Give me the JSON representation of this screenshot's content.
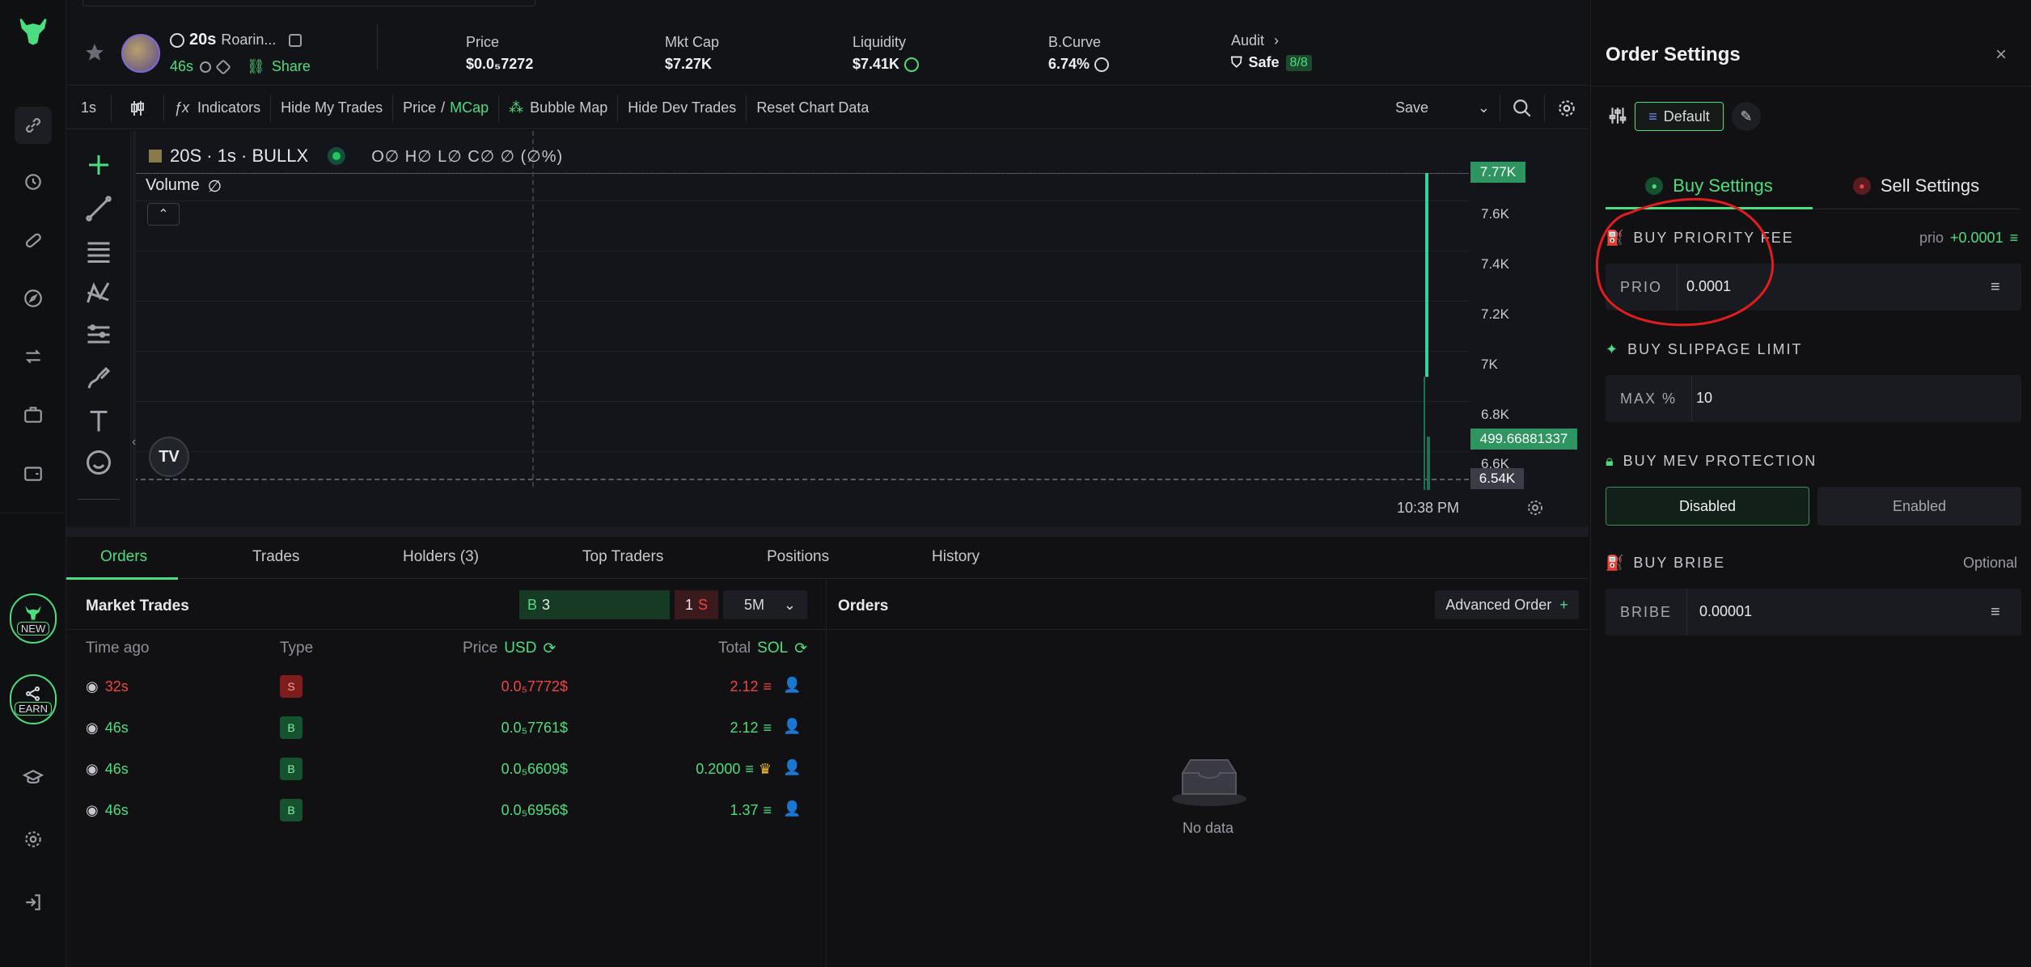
{
  "token": {
    "symbol": "20s",
    "name": "Roarin...",
    "age": "46s",
    "share_label": "Share"
  },
  "stats": [
    {
      "label": "Price",
      "value": "$0.0₅7272"
    },
    {
      "label": "Mkt Cap",
      "value": "$7.27K"
    },
    {
      "label": "Liquidity",
      "value": "$7.41K"
    },
    {
      "label": "B.Curve",
      "value": "6.74%"
    },
    {
      "label": "Audit",
      "value": "Safe",
      "badge": "8/8"
    }
  ],
  "toolbar": {
    "interval": "1s",
    "indicators": "Indicators",
    "hide_my_trades": "Hide My Trades",
    "price": "Price",
    "mcap": "MCap",
    "bubble_map": "Bubble Map",
    "hide_dev_trades": "Hide Dev Trades",
    "reset_chart": "Reset Chart Data",
    "save": "Save"
  },
  "chart": {
    "legend_title": "20S · 1s · BULLX",
    "ohlc": "O∅ H∅ L∅ C∅ ∅ (∅%)",
    "volume_label": "Volume",
    "volume_value": "∅",
    "price_ticks": [
      "7.6K",
      "7.4K",
      "7.2K",
      "7K",
      "6.8K",
      "6.6K"
    ],
    "top_tag": "7.77K",
    "volume_tag": "499.66881337",
    "last_tag": "6.54K",
    "time_label": "10:38 PM"
  },
  "tabs": [
    "Orders",
    "Trades",
    "Holders (3)",
    "Top Traders",
    "Positions",
    "History"
  ],
  "market_trades": {
    "title": "Market Trades",
    "buy_count": "3",
    "sell_count": "1",
    "buy_letter": "B",
    "sell_letter": "S",
    "interval": "5M",
    "headers": {
      "time": "Time ago",
      "type": "Type",
      "price": "Price",
      "price_unit": "USD",
      "total": "Total",
      "total_unit": "SOL"
    },
    "rows": [
      {
        "time": "32s",
        "type": "S",
        "price": "0.0₅7772$",
        "total": "2.12"
      },
      {
        "time": "46s",
        "type": "B",
        "price": "0.0₅7761$",
        "total": "2.12"
      },
      {
        "time": "46s",
        "type": "B",
        "price": "0.0₅6609$",
        "total": "0.2000"
      },
      {
        "time": "46s",
        "type": "B",
        "price": "0.0₅6956$",
        "total": "1.37"
      }
    ]
  },
  "orders": {
    "title": "Orders",
    "advanced_label": "Advanced Order",
    "empty_text": "No data"
  },
  "settings": {
    "title": "Order Settings",
    "preset": "Default",
    "buy_tab": "Buy Settings",
    "sell_tab": "Sell Settings",
    "priority": {
      "title": "BUY PRIORITY FEE",
      "hint_label": "prio",
      "hint_value": "+0.0001",
      "field_label": "PRIO",
      "value": "0.0001"
    },
    "slippage": {
      "title": "BUY SLIPPAGE LIMIT",
      "field_label": "MAX %",
      "value": "10"
    },
    "mev": {
      "title": "BUY MEV PROTECTION",
      "disabled": "Disabled",
      "enabled": "Enabled"
    },
    "bribe": {
      "title": "BUY BRIBE",
      "optional": "Optional",
      "field_label": "BRIBE",
      "value": "0.00001"
    }
  },
  "rail": {
    "new_label": "NEW",
    "earn_label": "EARN"
  },
  "colors": {
    "accent": "#4ade80",
    "danger": "#ef4444",
    "annotation": "#e11d1d"
  }
}
